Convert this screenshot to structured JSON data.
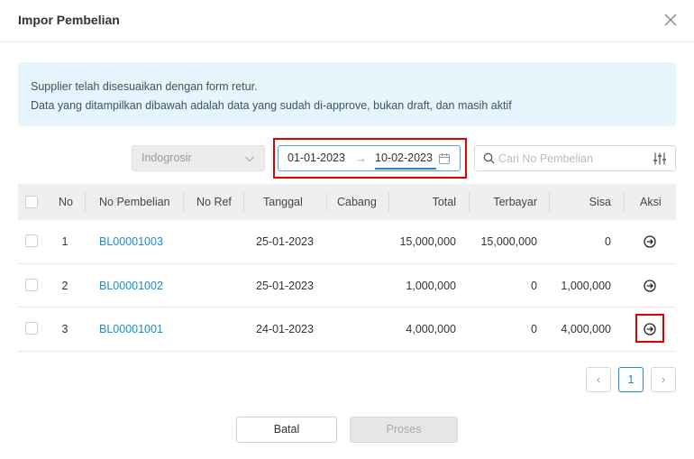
{
  "dialog": {
    "title": "Impor Pembelian"
  },
  "alert": {
    "line1": "Supplier telah disesuaikan dengan form retur.",
    "line2": "Data yang ditampilkan dibawah adalah data yang sudah di-approve, bukan draft, dan masih aktif"
  },
  "filters": {
    "supplier_value": "Indogrosir",
    "date_start": "01-01-2023",
    "date_arrow": "→",
    "date_end": "10-02-2023",
    "search_placeholder": "Cari No Pembelian"
  },
  "table": {
    "columns": {
      "no": "No",
      "no_pembelian": "No Pembelian",
      "no_ref": "No Ref",
      "tanggal": "Tanggal",
      "cabang": "Cabang",
      "total": "Total",
      "terbayar": "Terbayar",
      "sisa": "Sisa",
      "aksi": "Aksi"
    },
    "rows": [
      {
        "no": "1",
        "no_pembelian": "BL00001003",
        "no_ref": "",
        "tanggal": "25-01-2023",
        "cabang": "",
        "total": "15,000,000",
        "terbayar": "15,000,000",
        "sisa": "0"
      },
      {
        "no": "2",
        "no_pembelian": "BL00001002",
        "no_ref": "",
        "tanggal": "25-01-2023",
        "cabang": "",
        "total": "1,000,000",
        "terbayar": "0",
        "sisa": "1,000,000"
      },
      {
        "no": "3",
        "no_pembelian": "BL00001001",
        "no_ref": "",
        "tanggal": "24-01-2023",
        "cabang": "",
        "total": "4,000,000",
        "terbayar": "0",
        "sisa": "4,000,000"
      }
    ]
  },
  "pagination": {
    "prev": "‹",
    "current": "1",
    "next": "›"
  },
  "footer": {
    "cancel_label": "Batal",
    "process_label": "Proses"
  },
  "colors": {
    "accent": "#1a8ccd",
    "highlight": "#e00000",
    "alert_bg": "#e6f4fb"
  },
  "icons": [
    "close-icon",
    "chevron-down-icon",
    "calendar-icon",
    "search-icon",
    "filter-icon",
    "arrow-circle-right-icon"
  ]
}
